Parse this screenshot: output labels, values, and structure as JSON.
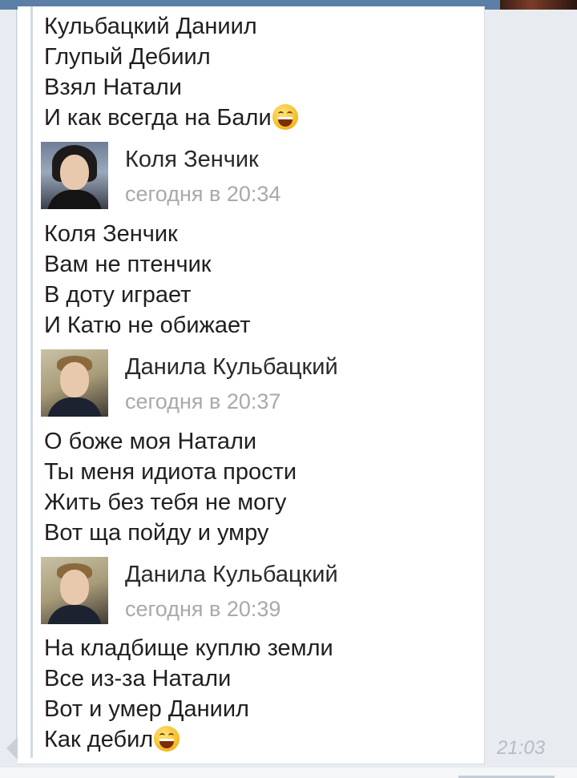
{
  "chat": {
    "blocks": [
      {
        "lines": [
          "Кульбацкий Даниил",
          "Глупый Дебиил",
          "Взял Натали",
          "И как всегда на Бали"
        ],
        "emoji_last_line": "grinning-face"
      }
    ],
    "posts": [
      {
        "author": "Коля Зенчик",
        "time": "сегодня в 20:34",
        "lines": [
          "Коля Зенчик",
          "Вам не птенчик",
          "В доту играет",
          "И Катю не обижает"
        ]
      },
      {
        "author": "Данила Кульбацкий",
        "time": "сегодня в 20:37",
        "lines": [
          "О боже моя Натали",
          "Ты меня идиота прости",
          "Жить без тебя не могу",
          "Вот ща пойду и умру"
        ]
      },
      {
        "author": "Данила Кульбацкий",
        "time": "сегодня в 20:39",
        "lines": [
          "На кладбище куплю земли",
          "Все из-за Натали",
          "Вот и умер Даниил",
          "Как дебил"
        ],
        "emoji_last_line": "grinning-face"
      }
    ],
    "message_time": "21:03"
  },
  "colors": {
    "topbar": "#5b7fa6",
    "bubble": "#ffffff",
    "timestamp": "#a9a9a9",
    "background": "#e8ecf0"
  }
}
